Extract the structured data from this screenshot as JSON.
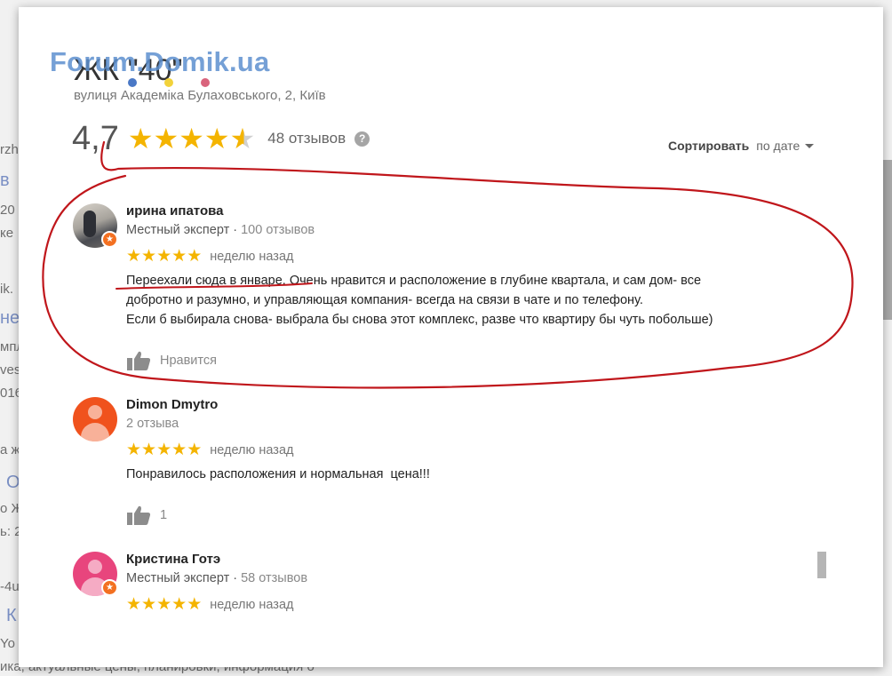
{
  "background": {
    "fragments": [
      "rzhi",
      "в",
      "20",
      "ке",
      "ik.",
      "не",
      "мпл",
      "ves",
      "016",
      "а ж",
      "О",
      "о Ж",
      "ь: 2",
      "-4u",
      "К",
      "Yo",
      "ика, актуальные цены, планировки, информация о"
    ]
  },
  "watermark": {
    "text": "Forum.Domik.ua",
    "dot_colors": [
      "#4a78c6",
      "#f2d23b",
      "#d9637c"
    ]
  },
  "place": {
    "title": "ЖК \"40\"",
    "address": "вулиця Академіка Булаховського, 2, Київ",
    "rating": "4,7",
    "stars_value": 4.7,
    "review_count": "48 отзывов",
    "help_icon": "?"
  },
  "sort": {
    "label": "Сортировать",
    "value": "по дате"
  },
  "reviews": [
    {
      "name": "ирина ипатова",
      "role": "Местный эксперт · ",
      "count": "100 отзывов",
      "stars": 5,
      "date": "неделю назад",
      "text": [
        "Переехали сюда в январе. Очень нравится и расположение в глубине квартала, и сам дом- все",
        "добротно и разумно, и управляющая компания- всегда на связи в чате и по телефону.",
        "Если б выбирала снова- выбрала бы снова этот комплекс, разве что квартиру бы чуть побольше)"
      ],
      "like_label": "Нравится",
      "avatar": "photo",
      "local_guide_badge": "star-badge-icon"
    },
    {
      "name": "Dimon Dmytro",
      "role": "",
      "count": "2 отзыва",
      "stars": 5,
      "date": "неделю назад",
      "text": [
        "Понравилось расположения и нормальная  цена!!!"
      ],
      "like_label": "1",
      "avatar": "orange"
    },
    {
      "name": "Кристина Готэ",
      "role": "Местный эксперт · ",
      "count": "58 отзывов",
      "stars": 5,
      "date": "неделю назад",
      "text": [],
      "like_label": "",
      "avatar": "pink",
      "local_guide_badge": "star-badge-icon"
    }
  ],
  "colors": {
    "star": "#f4b400",
    "annotation": "#c0161b",
    "badge": "#f37021"
  }
}
